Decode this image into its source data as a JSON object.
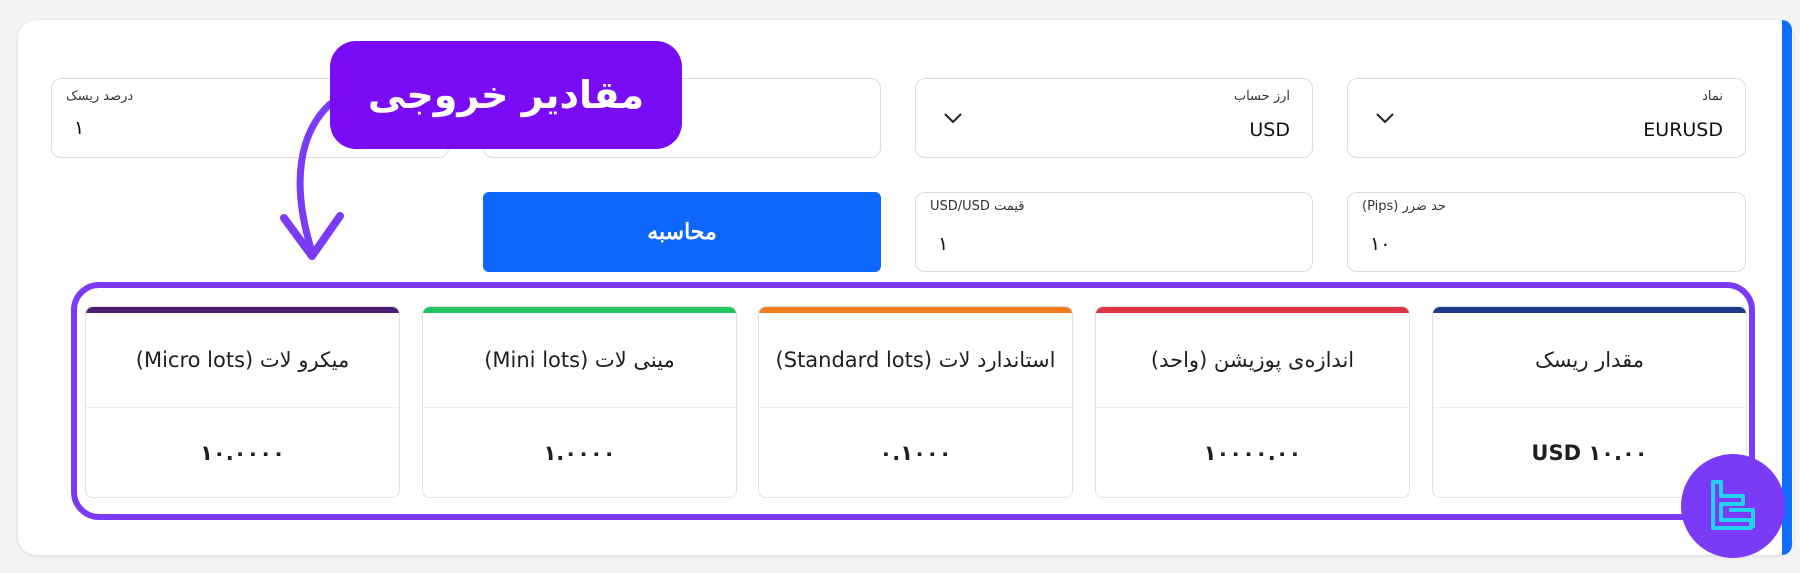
{
  "fields": {
    "symbol": {
      "label": "نماد",
      "value": "EURUSD"
    },
    "account_currency": {
      "label": "ارز حساب",
      "value": "USD"
    },
    "risk_percent": {
      "label": "درصد ریسک",
      "value": "۱"
    },
    "stop_loss": {
      "label": "حد ضرر (Pips)",
      "value": "۱۰"
    },
    "price": {
      "label": "قیمت USD/USD",
      "value": "۱"
    }
  },
  "calculate_button": {
    "label": "محاسبه"
  },
  "results": [
    {
      "title": "مقدار ریسک",
      "value": "USD ۱۰.۰۰",
      "color": "#1e3a8a"
    },
    {
      "title": "اندازه‌ی پوزیشن (واحد)",
      "value": "۱۰۰۰۰.۰۰",
      "color": "#dc3545"
    },
    {
      "title": "استاندارد لات (Standard lots)",
      "value": "۰.۱۰۰۰",
      "color": "#f07c1a"
    },
    {
      "title": "مینی لات (Mini lots)",
      "value": "۱.۰۰۰۰",
      "color": "#22c55e"
    },
    {
      "title": "میکرو لات (Micro lots)",
      "value": "۱۰.۰۰۰۰",
      "color": "#4c1d73"
    }
  ],
  "callout": {
    "text": "مقادیر خروجی"
  },
  "colors": {
    "primary_button": "#0d66fa",
    "highlight_purple": "#7b3af5",
    "callout_purple": "#7a0cf5"
  },
  "icons": {
    "dropdown": "chevron-down-icon",
    "brand": "brand-logo-icon"
  }
}
